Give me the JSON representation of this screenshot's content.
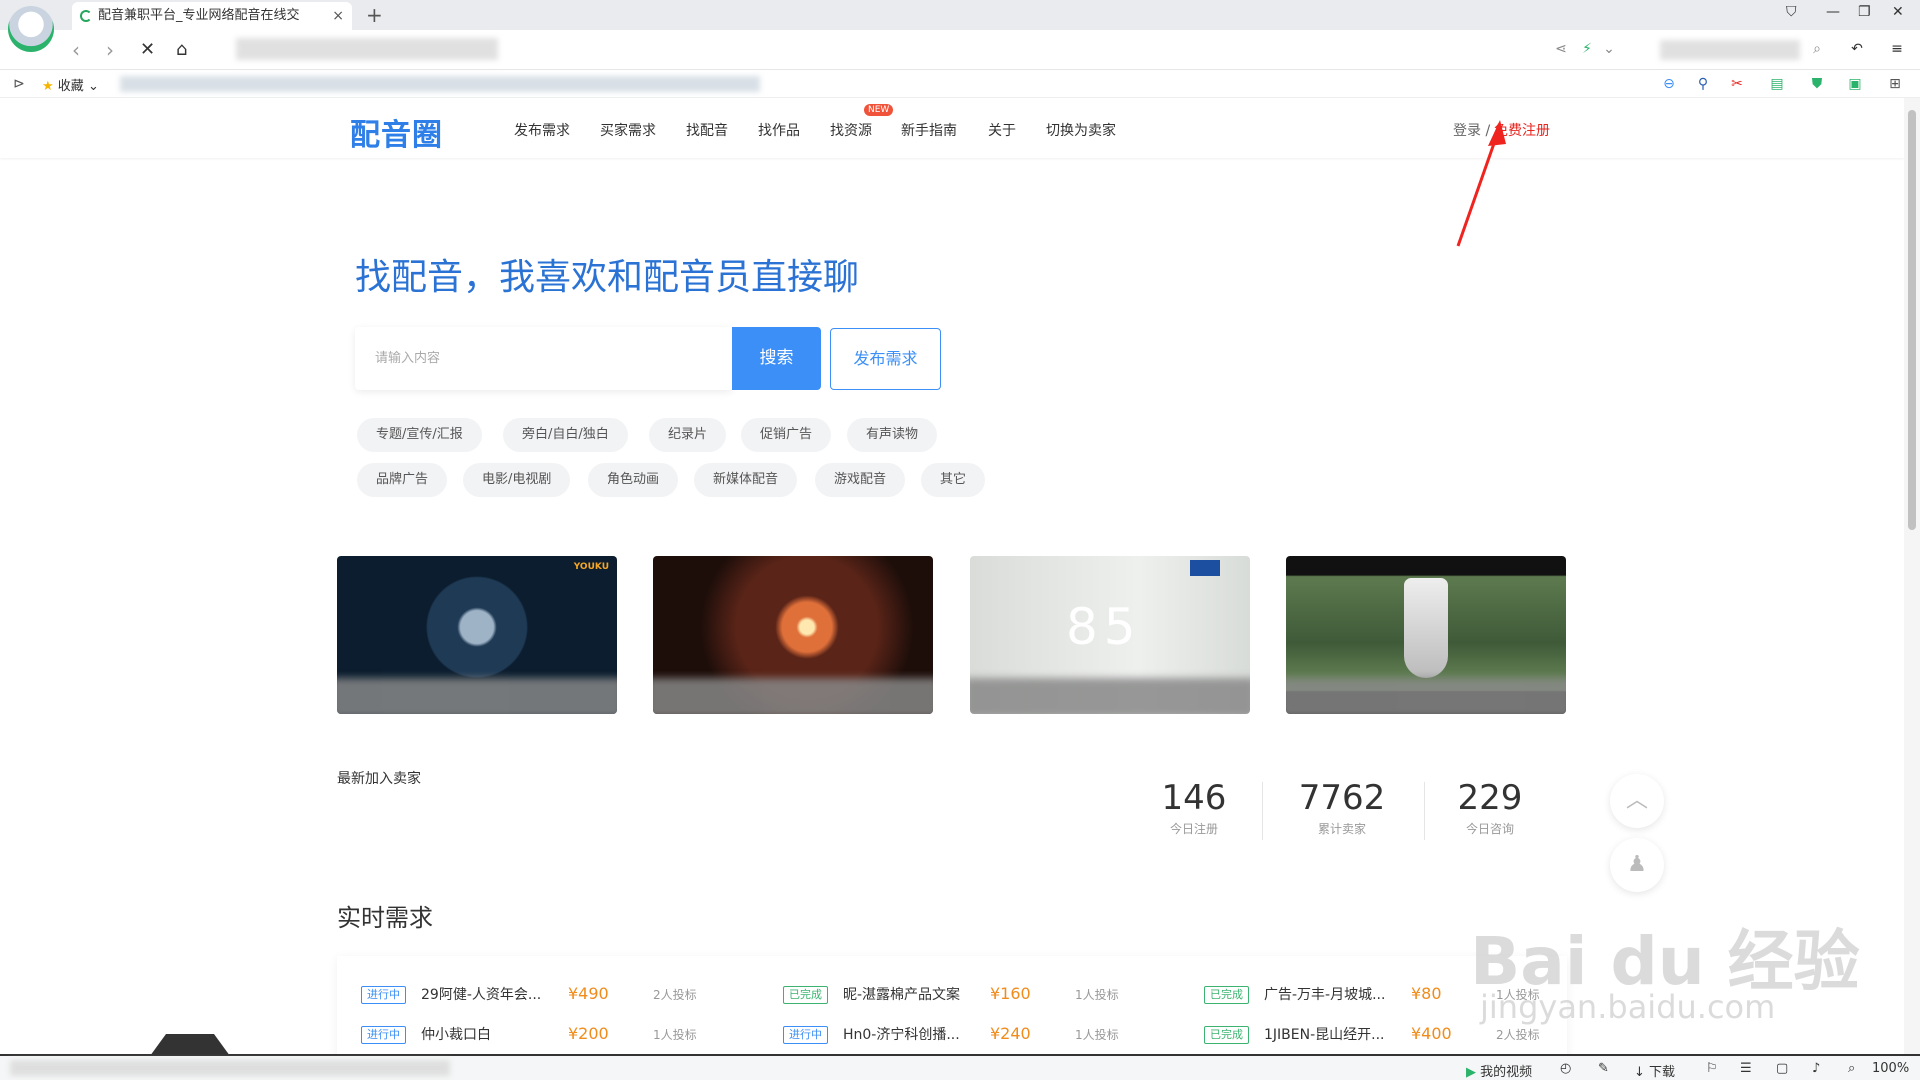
{
  "browser": {
    "tab_title": "配音兼职平台_专业网络配音在线交",
    "tab_close": "×",
    "new_tab": "+",
    "bookmarks_label": "收藏",
    "zoom": "100%",
    "status_items": [
      "我的视频",
      "下载"
    ]
  },
  "site": {
    "logo": "配音圈",
    "nav": [
      "发布需求",
      "买家需求",
      "找配音",
      "找作品",
      "找资源",
      "新手指南",
      "关于",
      "切换为卖家"
    ],
    "new_badge": "NEW",
    "login": "登录 /",
    "register": "免费注册",
    "hero_title": "找配音，我喜欢和配音员直接聊",
    "search_placeholder": "请输入内容",
    "search_button": "搜索",
    "publish_button": "发布需求",
    "tags_row1": [
      "专题/宣传/汇报",
      "旁白/自白/独白",
      "纪录片",
      "促销广告",
      "有声读物"
    ],
    "tags_row2": [
      "品牌广告",
      "电影/电视剧",
      "角色动画",
      "新媒体配音",
      "游戏配音",
      "其它"
    ],
    "seller_section_title": "最新加入卖家",
    "stats": [
      {
        "value": "146",
        "label": "今日注册"
      },
      {
        "value": "7762",
        "label": "累计卖家"
      },
      {
        "value": "229",
        "label": "今日咨询"
      }
    ],
    "realtime_title": "实时需求",
    "demands": [
      {
        "status": "进行中",
        "title": "29阿健-人资年会...",
        "price": "¥490",
        "bids": "2人投标"
      },
      {
        "status": "已完成",
        "title": "昵-湛露棉产品文案",
        "price": "¥160",
        "bids": "1人投标"
      },
      {
        "status": "已完成",
        "title": "广告-万丰-月坡城...",
        "price": "¥80",
        "bids": "1人投标"
      },
      {
        "status": "进行中",
        "title": "仲小裁口白",
        "price": "¥200",
        "bids": "1人投标"
      },
      {
        "status": "进行中",
        "title": "Hn0-济宁科创播...",
        "price": "¥240",
        "bids": "1人投标"
      },
      {
        "status": "已完成",
        "title": "1JIBEN-昆山经开...",
        "price": "¥400",
        "bids": "2人投标"
      }
    ],
    "watermark": "Bai du 经验",
    "watermark_url": "jingyan.baidu.com",
    "colors": {
      "primary": "#3b8ff7",
      "accent_red": "#e8251f",
      "price": "#f08c1b",
      "done_green": "#3cb371"
    }
  }
}
